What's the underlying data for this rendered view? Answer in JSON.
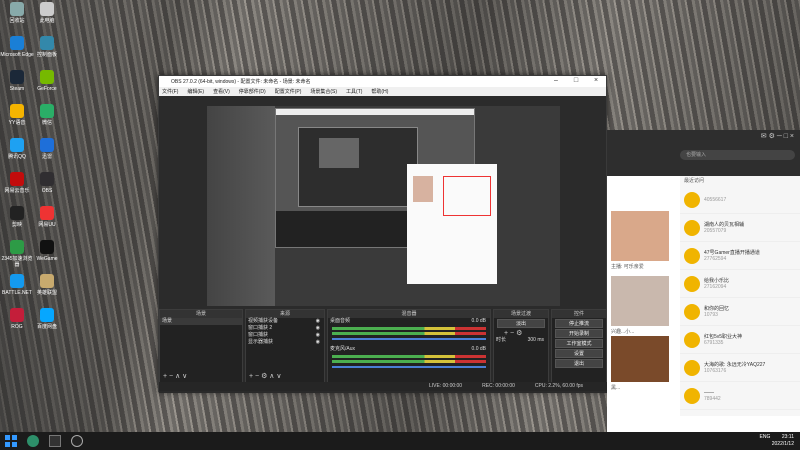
{
  "desktop_icons": [
    {
      "label": "回收站",
      "color": "#8aa"
    },
    {
      "label": "Microsoft Edge",
      "color": "#1a7fd6"
    },
    {
      "label": "Steam",
      "color": "#1b2838"
    },
    {
      "label": "YY语音",
      "color": "#f5b400"
    },
    {
      "label": "腾讯QQ",
      "color": "#1ea1f2"
    },
    {
      "label": "网易云音乐",
      "color": "#c20c0c"
    },
    {
      "label": "剪映",
      "color": "#222"
    },
    {
      "label": "2345加速浏览器",
      "color": "#2d9b46"
    },
    {
      "label": "BATTLE.NET",
      "color": "#149aef"
    },
    {
      "label": "ROG",
      "color": "#c41e3a"
    }
  ],
  "desktop_icons_col2": [
    {
      "label": "此电脑",
      "color": "#ccc"
    },
    {
      "label": "控制面板",
      "color": "#38a"
    },
    {
      "label": "GeForce",
      "color": "#76b900"
    },
    {
      "label": "微信",
      "color": "#2aae67"
    },
    {
      "label": "迅雷",
      "color": "#1e6fd9"
    },
    {
      "label": "OBS",
      "color": "#302e31"
    },
    {
      "label": "网易UU",
      "color": "#e33"
    },
    {
      "label": "WeGame",
      "color": "#111"
    },
    {
      "label": "英雄联盟",
      "color": "#c8aa6e"
    },
    {
      "label": "百度网盘",
      "color": "#06a7ff"
    }
  ],
  "obs": {
    "title": "OBS 27.0.2 (64-bit, windows) - 配置文件: 未命名 - 场景: 未命名",
    "menu": [
      "文件(F)",
      "编辑(E)",
      "查看(V)",
      "停靠部件(D)",
      "配置文件(P)",
      "场景集合(S)",
      "工具(T)",
      "帮助(H)"
    ],
    "docks": {
      "scenes": {
        "title": "场景",
        "items": [
          "场景"
        ]
      },
      "sources": {
        "title": "来源",
        "items": [
          "视频捕获设备",
          "窗口捕获 2",
          "窗口捕获",
          "显示器捕获"
        ]
      },
      "mixer": {
        "title": "混音器",
        "channels": [
          {
            "name": "桌面音频",
            "db": "0.0 dB"
          },
          {
            "name": "麦克风/Aux",
            "db": "0.0 dB"
          }
        ]
      },
      "transitions": {
        "title": "场景过渡",
        "type": "淡出",
        "duration_label": "时长",
        "duration": "300 ms"
      },
      "controls": {
        "title": "控件",
        "buttons": [
          "停止推流",
          "开始录制",
          "工作室模式",
          "设置",
          "退出"
        ]
      }
    },
    "status": {
      "live": "LIVE: 00:00:00",
      "rec": "REC: 00:00:00",
      "cpu": "CPU: 2.2%, 60.00 fps"
    }
  },
  "chat": {
    "search_placeholder": "也要输入",
    "section_label": "最近访问",
    "items": [
      {
        "title": "",
        "sub": "40556617"
      },
      {
        "title": "湖南人的贝瓦相辅",
        "sub": "20557079"
      },
      {
        "title": "47号Gamer直播开播通道",
        "sub": "27762594"
      },
      {
        "title": "给我小乐比",
        "sub": "27162094"
      },
      {
        "title": "和你的回忆",
        "sub": "10793"
      },
      {
        "title": "红包5v5职业大神",
        "sub": "6791335"
      },
      {
        "title": "大海的歌: 永远无冷YAQ227",
        "sub": "10763176"
      },
      {
        "title": "——",
        "sub": "789442"
      }
    ],
    "feed_labels": [
      "主播: 可乐亲爱",
      "兴趣...小...",
      "黑...",
      "颂..."
    ]
  },
  "taskbar": {
    "time": "23:11",
    "date": "2022/1/12",
    "lang": "ENG"
  }
}
